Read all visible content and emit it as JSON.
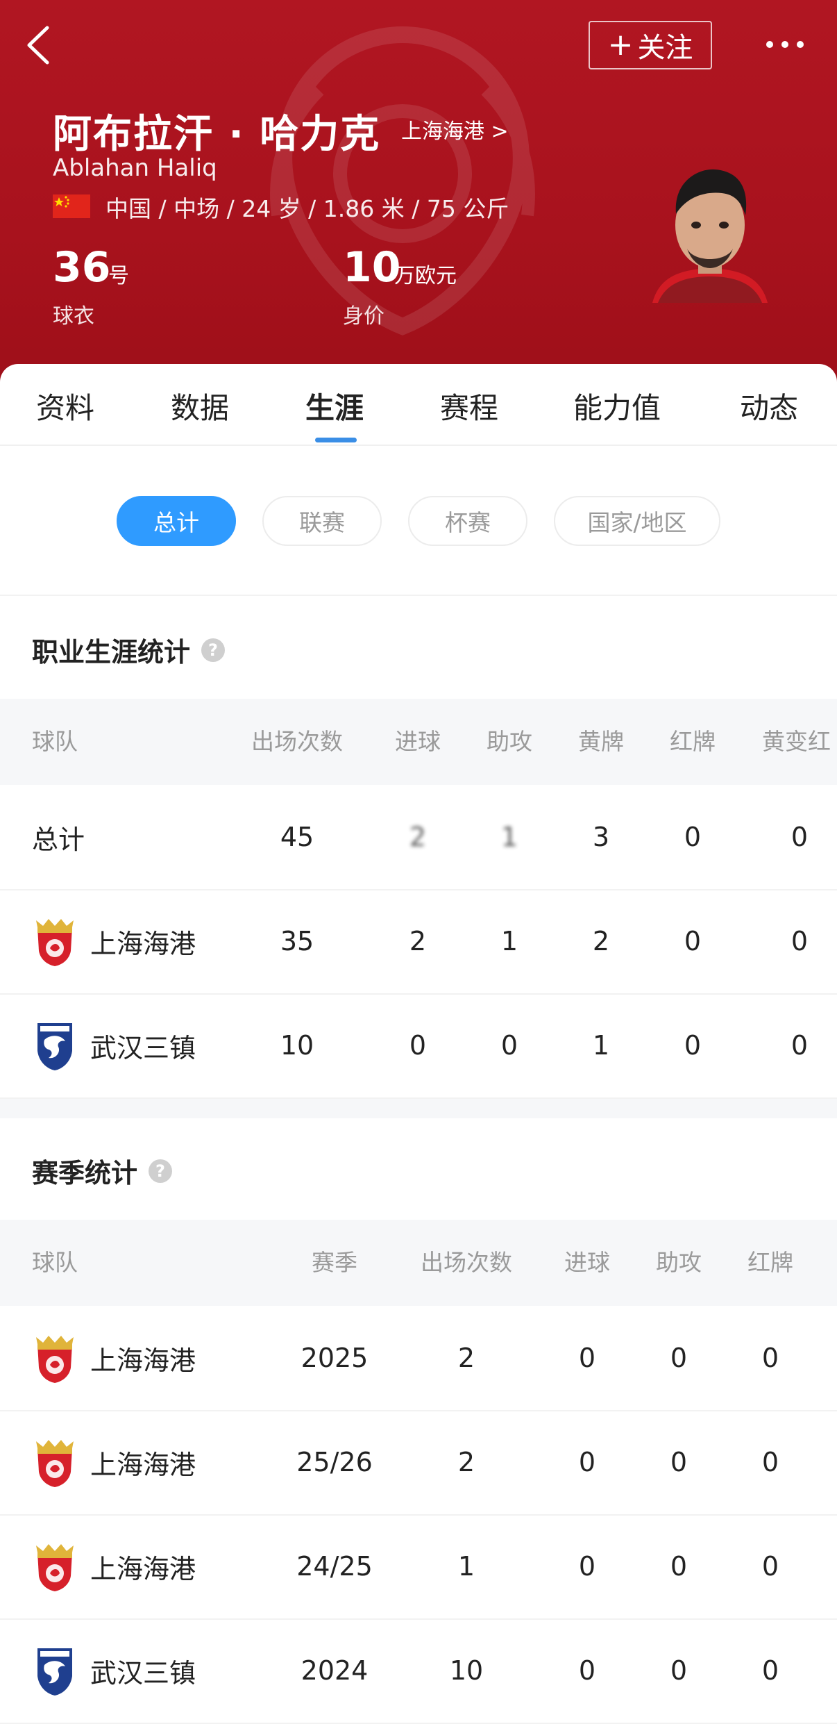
{
  "header": {
    "follow_label": "关注",
    "name": "阿布拉汗 · 哈力克",
    "name_en": "Ablahan Haliq",
    "team_link": "上海海港 >",
    "meta": "中国 / 中场 / 24 岁 / 1.86 米 / 75 公斤",
    "jersey": {
      "value": "36",
      "unit": "号",
      "label": "球衣"
    },
    "market_value": {
      "value": "10",
      "unit": "万欧元",
      "label": "身价"
    }
  },
  "tabs": [
    "资料",
    "数据",
    "生涯",
    "赛程",
    "能力值",
    "动态"
  ],
  "active_tab": "生涯",
  "filters": [
    "总计",
    "联赛",
    "杯赛",
    "国家/地区"
  ],
  "career": {
    "title": "职业生涯统计",
    "headers": [
      "球队",
      "出场次数",
      "进球",
      "助攻",
      "黄牌",
      "红牌",
      "黄变红"
    ],
    "rows": [
      {
        "team": "总计",
        "logo": "",
        "cols": [
          "45",
          "2",
          "1",
          "3",
          "0",
          "0"
        ]
      },
      {
        "team": "上海海港",
        "logo": "shanghai-port-logo-icon",
        "cols": [
          "35",
          "2",
          "1",
          "2",
          "0",
          "0"
        ]
      },
      {
        "team": "武汉三镇",
        "logo": "wuhan-three-towns-logo-icon",
        "cols": [
          "10",
          "0",
          "0",
          "1",
          "0",
          "0"
        ]
      }
    ]
  },
  "season": {
    "title": "赛季统计",
    "headers": [
      "球队",
      "赛季",
      "出场次数",
      "进球",
      "助攻",
      "红牌"
    ],
    "rows": [
      {
        "team": "上海海港",
        "logo": "shanghai-port-logo-icon",
        "cols": [
          "2025",
          "2",
          "0",
          "0",
          "0"
        ]
      },
      {
        "team": "上海海港",
        "logo": "shanghai-port-logo-icon",
        "cols": [
          "25/26",
          "2",
          "0",
          "0",
          "0"
        ]
      },
      {
        "team": "上海海港",
        "logo": "shanghai-port-logo-icon",
        "cols": [
          "24/25",
          "1",
          "0",
          "0",
          "0"
        ]
      },
      {
        "team": "武汉三镇",
        "logo": "wuhan-three-towns-logo-icon",
        "cols": [
          "2024",
          "10",
          "0",
          "0",
          "0"
        ]
      }
    ]
  },
  "colors": {
    "header_red": "#a8121d",
    "accent_blue": "#2f9bff",
    "tab_indicator": "#3a8ee6"
  }
}
